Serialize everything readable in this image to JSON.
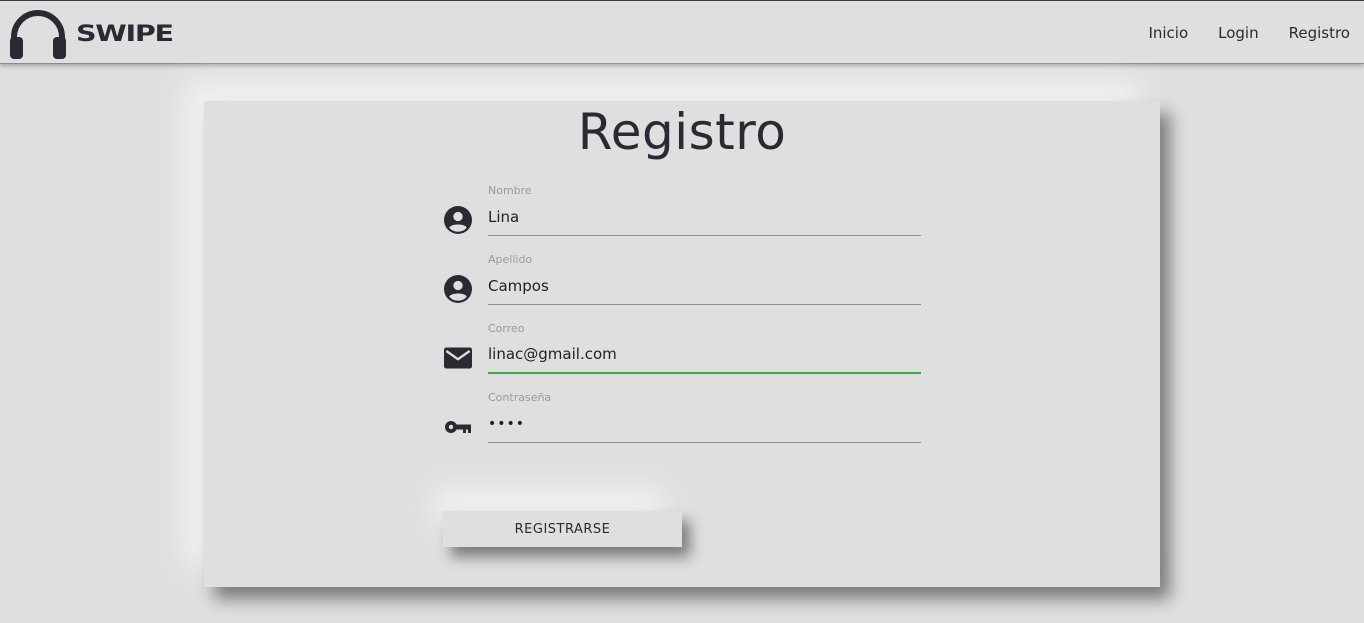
{
  "brand": {
    "name": "SWIPE",
    "icon": "headphones-icon"
  },
  "nav": {
    "items": [
      {
        "label": "Inicio"
      },
      {
        "label": "Login"
      },
      {
        "label": "Registro"
      }
    ]
  },
  "form": {
    "title": "Registro",
    "fields": [
      {
        "label": "Nombre",
        "value": "Lina",
        "icon": "account-circle-icon"
      },
      {
        "label": "Apellido",
        "value": "Campos",
        "icon": "account-circle-icon"
      },
      {
        "label": "Correo",
        "value": "linac@gmail.com",
        "icon": "mail-icon"
      },
      {
        "label": "Contraseña",
        "value": "••••",
        "icon": "key-icon"
      }
    ],
    "submit_label": "REGISTRARSE"
  },
  "colors": {
    "background": "#dfdfdf",
    "text": "#2b2a33",
    "focus_underline": "#3aa845"
  }
}
